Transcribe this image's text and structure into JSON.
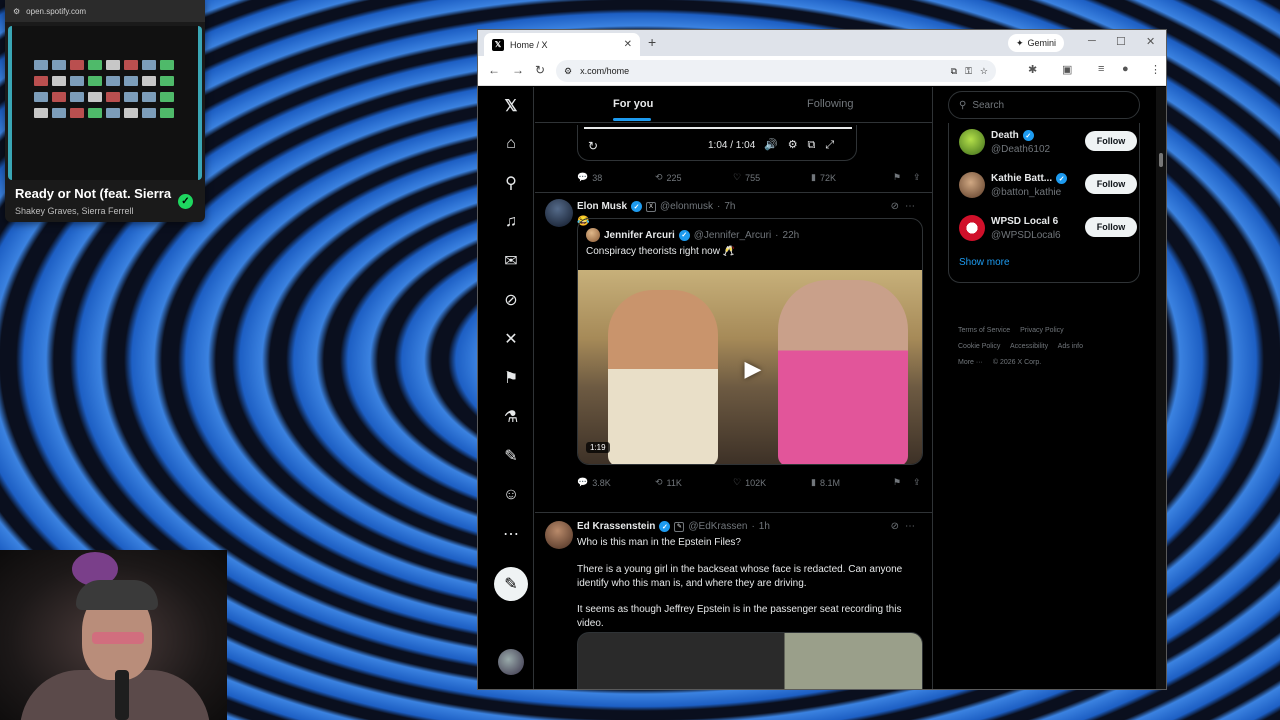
{
  "spotify": {
    "url": "open.spotify.com",
    "song": "Ready or Not (feat. Sierra",
    "artist": "Shakey Graves, Sierra Ferrell"
  },
  "browser": {
    "tab_title": "Home / X",
    "gemini_label": "Gemini",
    "url": "x.com/home"
  },
  "feed": {
    "tabs": [
      "For you",
      "Following"
    ],
    "video_time": "1:04 / 1:04",
    "prev_post_stats": {
      "replies": "38",
      "reposts": "225",
      "likes": "755",
      "views": "72K"
    },
    "posts": [
      {
        "name": "Elon Musk",
        "handle": "@elonmusk",
        "time": "7h",
        "text": "😂",
        "quote": {
          "name": "Jennifer Arcuri",
          "handle": "@Jennifer_Arcuri",
          "time": "22h",
          "text": "Conspiracy theorists right now 🥂",
          "duration": "1:19"
        },
        "stats": {
          "replies": "3.8K",
          "reposts": "11K",
          "likes": "102K",
          "views": "8.1M"
        }
      },
      {
        "name": "Ed Krassenstein",
        "handle": "@EdKrassen",
        "time": "1h",
        "paragraphs": [
          "Who is this man in the Epstein Files?",
          "There is a young girl in the backseat whose face is redacted. Can anyone identify who this man is, and where they are driving.",
          "It seems as though Jeffrey Epstein is in the passenger seat recording this video."
        ]
      }
    ]
  },
  "sidebar": {
    "search_placeholder": "Search",
    "who_to_follow": [
      {
        "name": "Death",
        "handle": "@Death6102",
        "button": "Follow"
      },
      {
        "name": "Kathie Batt...",
        "handle": "@batton_kathie",
        "button": "Follow"
      },
      {
        "name": "WPSD Local 6",
        "handle": "@WPSDLocal6",
        "button": "Follow"
      }
    ],
    "show_more": "Show more",
    "footer": [
      "Terms of Service",
      "Privacy Policy",
      "Cookie Policy",
      "Accessibility",
      "Ads info",
      "More ···",
      "© 2026 X Corp."
    ]
  },
  "colors": {
    "accent": "#1d9bf0",
    "background": "#000000"
  }
}
